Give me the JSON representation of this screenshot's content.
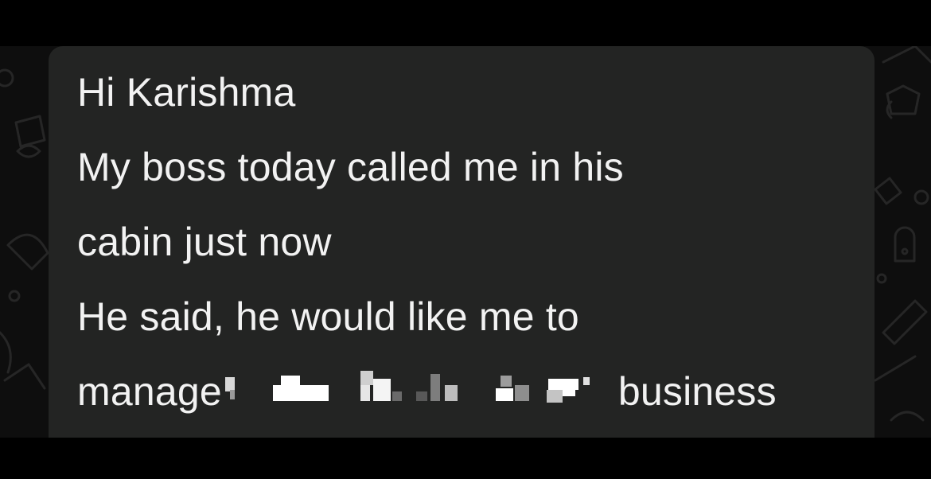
{
  "chat": {
    "message": {
      "lines": [
        "Hi Karishma",
        "My boss today called me in his",
        "cabin just now",
        "He said, he would like me to"
      ],
      "last_line_start": "manage",
      "last_line_end": "business",
      "redacted": true
    }
  },
  "colors": {
    "bubble": "#232423",
    "text": "#f2f2f2",
    "wallpaper": "#0e0e0e",
    "bars": "#000000"
  }
}
